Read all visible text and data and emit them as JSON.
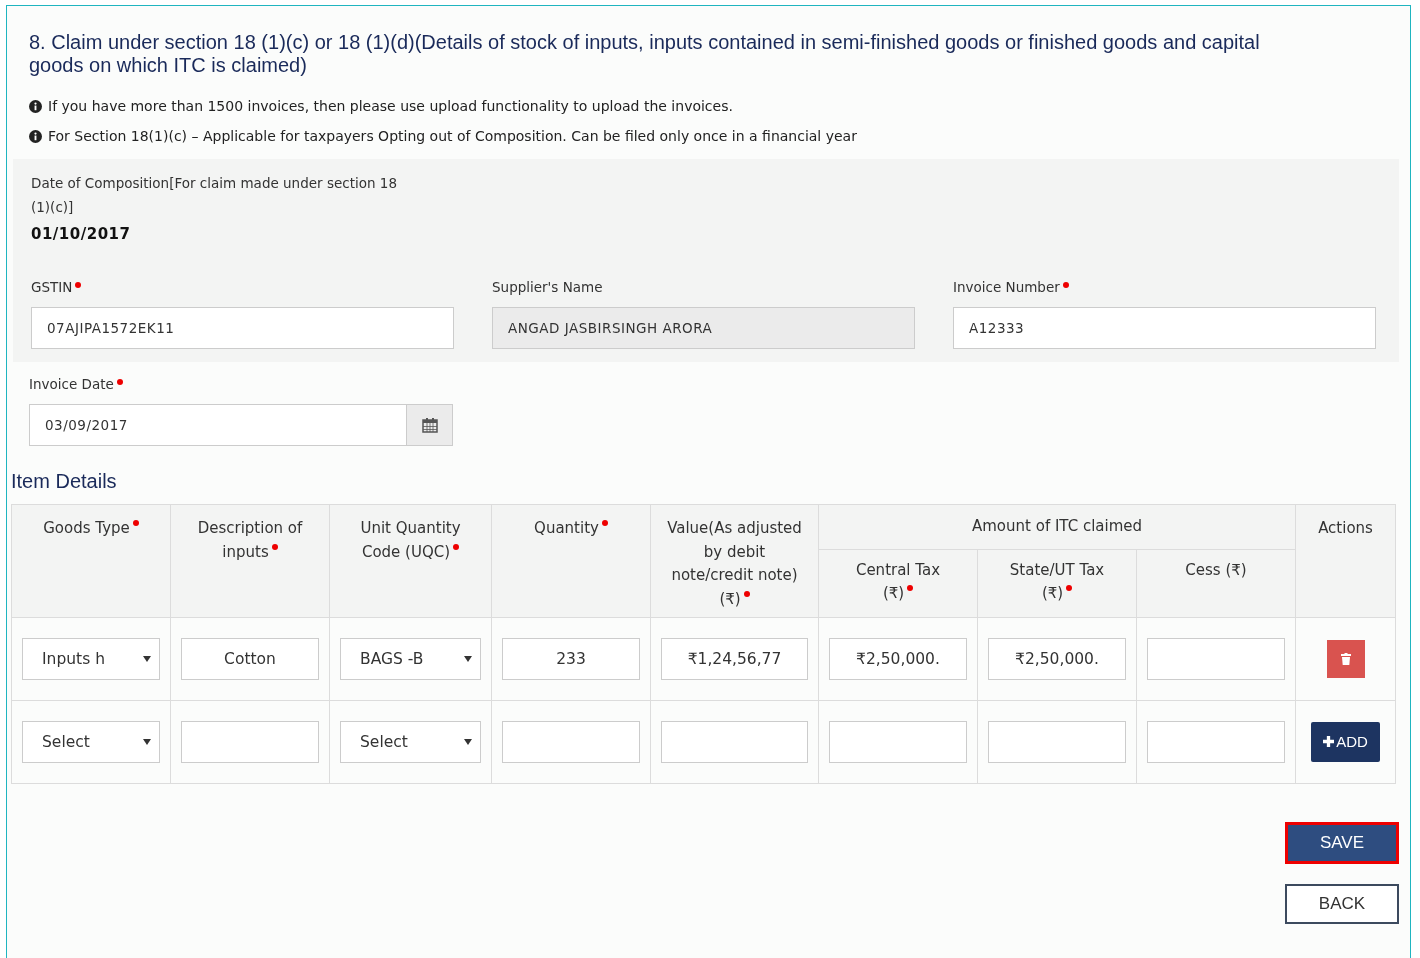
{
  "section_title": "8. Claim under section 18 (1)(c) or 18 (1)(d)(Details of stock of inputs, inputs contained in semi-finished goods or finished goods and capital goods on which ITC is claimed)",
  "notes": [
    "If you have more than 1500 invoices, then please use upload functionality to upload the invoices.",
    "For Section 18(1)(c) – Applicable for taxpayers Opting out of Composition. Can be filed only once in a financial year"
  ],
  "composition": {
    "label": "Date of Composition[For claim made under section 18 (1)(c)]",
    "value": "01/10/2017"
  },
  "fields": [
    {
      "label": "GSTIN",
      "required": true,
      "value": "07AJIPA1572EK11",
      "disabled": false
    },
    {
      "label": "Supplier's Name",
      "value": "ANGAD JASBIRSINGH ARORA",
      "disabled": true
    },
    {
      "label": "Invoice Number",
      "required": true,
      "value": "A12333",
      "disabled": false
    }
  ],
  "invoice_date": {
    "label": "Invoice Date",
    "required": true,
    "value": "03/09/2017"
  },
  "item_details_title": "Item Details",
  "table": {
    "columns": [
      {
        "label": "Goods Type",
        "required": true
      },
      {
        "label": "Description of inputs",
        "required": true
      },
      {
        "label": "Unit Quantity Code (UQC)",
        "required": true
      },
      {
        "label": "Quantity",
        "required": true
      },
      {
        "label": "Value(As adjusted by debit note/credit note)(₹)",
        "required": true
      }
    ],
    "group": {
      "label": "Amount of ITC claimed",
      "columns": [
        {
          "label": "Central Tax (₹)",
          "required": true
        },
        {
          "label": "State/UT Tax (₹)",
          "required": true
        },
        {
          "label": "Cess (₹)"
        }
      ]
    },
    "actions_label": "Actions",
    "rows": [
      {
        "cells": [
          {
            "kind": "select",
            "value": "Inputs h"
          },
          {
            "kind": "text",
            "value": "Cotton"
          },
          {
            "kind": "select",
            "value": "BAGS -B"
          },
          {
            "kind": "text",
            "value": "233"
          },
          {
            "kind": "text",
            "value": "₹1,24,56,77"
          },
          {
            "kind": "text",
            "value": "₹2,50,000."
          },
          {
            "kind": "text",
            "value": "₹2,50,000."
          },
          {
            "kind": "text"
          }
        ],
        "action": {
          "kind": "delete"
        }
      },
      {
        "cells": [
          {
            "kind": "select",
            "value": "Select"
          },
          {
            "kind": "text"
          },
          {
            "kind": "select",
            "value": "Select"
          },
          {
            "kind": "text"
          },
          {
            "kind": "text"
          },
          {
            "kind": "text"
          },
          {
            "kind": "text"
          },
          {
            "kind": "text"
          }
        ],
        "action": {
          "kind": "add",
          "label": "ADD"
        }
      }
    ]
  },
  "buttons": [
    {
      "label": "SAVE",
      "kind": "primary",
      "highlighted": true
    },
    {
      "label": "BACK",
      "kind": "secondary",
      "highlighted": false
    }
  ]
}
